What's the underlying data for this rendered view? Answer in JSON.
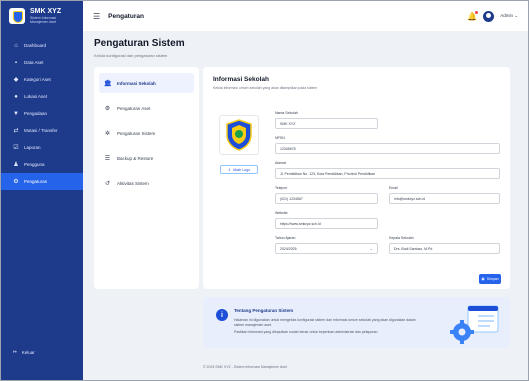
{
  "brand": {
    "name": "SMK XYZ",
    "tagline_1": "Sistem Informasi",
    "tagline_2": "Manajemen Aset"
  },
  "sidebar": {
    "items": [
      {
        "label": "Dashboard",
        "icon": "home-icon"
      },
      {
        "label": "Data Aset",
        "icon": "box-icon"
      },
      {
        "label": "Kategori Aset",
        "icon": "tag-icon"
      },
      {
        "label": "Lokasi Aset",
        "icon": "location-icon"
      },
      {
        "label": "Pengadaan",
        "icon": "cart-icon"
      },
      {
        "label": "Mutasi / Transfer",
        "icon": "transfer-icon"
      },
      {
        "label": "Laporan",
        "icon": "report-icon"
      },
      {
        "label": "Pengguna",
        "icon": "users-icon"
      },
      {
        "label": "Pengaturan",
        "icon": "gear-icon",
        "active": true
      }
    ],
    "logout_label": "Keluar"
  },
  "topbar": {
    "title": "Pengaturan",
    "user": "Admin"
  },
  "page": {
    "title": "Pengaturan Sistem",
    "subtitle": "Kelola konfigurasi dan pengaturan sistem"
  },
  "tabs": [
    {
      "label": "Informasi Sekolah",
      "active": true
    },
    {
      "label": "Pengaturan Aset"
    },
    {
      "label": "Pengaturan Sistem"
    },
    {
      "label": "Backup & Restore"
    },
    {
      "label": "Aktivitas Sistem"
    }
  ],
  "form": {
    "title": "Informasi Sekolah",
    "subtitle": "Kelola informasi umum sekolah yang akan ditampilkan pada sistem",
    "upload_label": "Ubah Logo",
    "fields": {
      "nama_label": "Nama Sekolah",
      "nama_value": "SMK XYZ",
      "npsn_label": "NPSN",
      "npsn_value": "12345678",
      "alamat_label": "Alamat",
      "alamat_value": "Jl. Pendidikan No. 123, Kota Pendidikan, Provinsi Pendidikan",
      "telepon_label": "Telepon",
      "telepon_value": "(021) 1234567",
      "email_label": "Email",
      "email_value": "info@smkxyz.sch.id",
      "website_label": "Website",
      "website_value": "https://www.smkxyz.sch.id",
      "tahun_label": "Tahun Ajaran",
      "tahun_value": "2024/2025",
      "kepsek_label": "Kepala Sekolah",
      "kepsek_value": "Drs. Budi Santoso, M.Pd"
    },
    "save_label": "Simpan"
  },
  "info": {
    "title": "Tentang Pengaturan Sistem",
    "line1": "Halaman ini digunakan untuk mengelola konfigurasi sistem dan informasi umum sekolah yang akan digunakan dalam sistem manajemen aset.",
    "line2": "Pastikan informasi yang diinputkan sudah benar untuk keperluan administrasi dan pelaporan."
  },
  "footer": "© 2024 SMK XYZ - Sistem Informasi Manajemen Aset",
  "colors": {
    "sidebar": "#1e3a8a",
    "accent": "#2563eb",
    "info_bg": "#e8eefc"
  }
}
